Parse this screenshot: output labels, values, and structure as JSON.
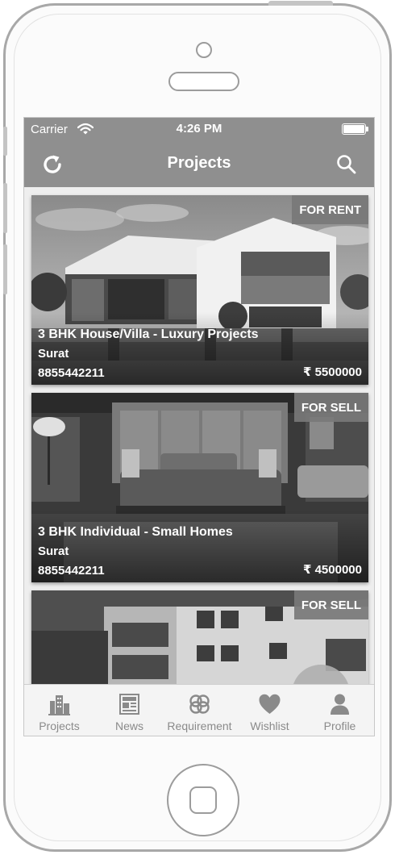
{
  "status_bar": {
    "carrier": "Carrier",
    "time": "4:26 PM",
    "wifi_icon": "wifi-icon",
    "battery_icon": "battery-full-icon"
  },
  "nav": {
    "title": "Projects",
    "left_icon": "refresh-icon",
    "right_icon": "search-icon"
  },
  "cards": [
    {
      "badge": "FOR RENT",
      "title": "3 BHK House/Villa - Luxury Projects",
      "city": "Surat",
      "phone": "8855442211",
      "price": "₹ 5500000",
      "image": "modern-villa-photo"
    },
    {
      "badge": "FOR SELL",
      "title": "3 BHK Individual - Small Homes",
      "city": "Surat",
      "phone": "8855442211",
      "price": "₹ 4500000",
      "image": "bedroom-interior-photo"
    },
    {
      "badge": "FOR SELL",
      "image": "apartment-building-photo"
    }
  ],
  "map_button": {
    "icon": "map-icon"
  },
  "tabs": [
    {
      "label": "Projects",
      "icon": "buildings-icon"
    },
    {
      "label": "News",
      "icon": "newspaper-icon"
    },
    {
      "label": "Requirement",
      "icon": "requirement-icon"
    },
    {
      "label": "Wishlist",
      "icon": "heart-icon"
    },
    {
      "label": "Profile",
      "icon": "person-icon"
    }
  ],
  "colors": {
    "bar": "#8f8f8f",
    "tab_icon": "#8a8a8a",
    "badge": "#787878"
  }
}
